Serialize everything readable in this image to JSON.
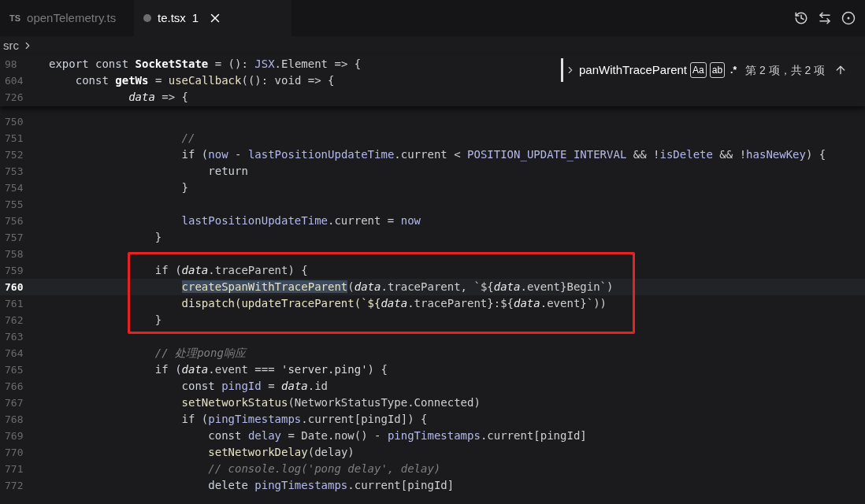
{
  "tabs": [
    {
      "badge": "TS",
      "label": "openTelemetry.ts",
      "selected": false
    },
    {
      "label": "te.tsx",
      "problems": "1",
      "selected": true
    }
  ],
  "breadcrumbs": [
    "src"
  ],
  "sticky_lines": [
    {
      "number": "98",
      "code": [
        {
          "text": "export const ",
          "kind": "kw"
        },
        {
          "text": "SocketState",
          "kind": "b"
        },
        {
          "text": " = (): ",
          "kind": "p"
        },
        {
          "text": "JSX",
          "kind": "var"
        },
        {
          "text": ".Element => {",
          "kind": "p"
        }
      ]
    },
    {
      "number": "604",
      "code": [
        {
          "text": "    const ",
          "kind": "kw"
        },
        {
          "text": "getWs",
          "kind": "b"
        },
        {
          "text": " = ",
          "kind": "p"
        },
        {
          "text": "useCallback",
          "kind": "fn"
        },
        {
          "text": "((): void => {",
          "kind": "p"
        }
      ]
    },
    {
      "number": "726",
      "code": [
        {
          "text": "            data",
          "kind": "it"
        },
        {
          "text": " => {",
          "kind": "p"
        }
      ]
    }
  ],
  "lines": [
    {
      "number": "750",
      "current": false
    },
    {
      "number": "751",
      "current": false,
      "code": [
        {
          "text": "                    //",
          "kind": "cm"
        }
      ]
    },
    {
      "number": "752",
      "current": false,
      "code": [
        {
          "text": "                    if (",
          "kind": "kw"
        },
        {
          "text": "now",
          "kind": "var"
        },
        {
          "text": " - ",
          "kind": "p"
        },
        {
          "text": "lastPositionUpdateTime",
          "kind": "var"
        },
        {
          "text": ".current < ",
          "kind": "p"
        },
        {
          "text": "POSITION_UPDATE_INTERVAL",
          "kind": "var"
        },
        {
          "text": " && !",
          "kind": "p"
        },
        {
          "text": "isDelete",
          "kind": "var"
        },
        {
          "text": " && !",
          "kind": "p"
        },
        {
          "text": "hasNewKey",
          "kind": "var"
        },
        {
          "text": ") {",
          "kind": "p"
        }
      ]
    },
    {
      "number": "753",
      "current": false,
      "code": [
        {
          "text": "                        return",
          "kind": "kw"
        }
      ]
    },
    {
      "number": "754",
      "current": false,
      "code": [
        {
          "text": "                    }",
          "kind": "p"
        }
      ]
    },
    {
      "number": "755",
      "current": false
    },
    {
      "number": "756",
      "current": false,
      "code": [
        {
          "text": "                    lastPositionUpdateTime",
          "kind": "var"
        },
        {
          "text": ".current = ",
          "kind": "p"
        },
        {
          "text": "now",
          "kind": "var"
        }
      ]
    },
    {
      "number": "757",
      "current": false,
      "code": [
        {
          "text": "                }",
          "kind": "p"
        }
      ]
    },
    {
      "number": "758",
      "current": false
    },
    {
      "number": "759",
      "current": false,
      "code": [
        {
          "text": "                if (",
          "kind": "kw"
        },
        {
          "text": "data",
          "kind": "it"
        },
        {
          "text": ".traceParent) {",
          "kind": "p"
        }
      ]
    },
    {
      "number": "760",
      "current": true,
      "code": [
        {
          "text": "                    createSpanWithTraceParent",
          "kind": "sel"
        },
        {
          "text": "(",
          "kind": "p"
        },
        {
          "text": "data",
          "kind": "it"
        },
        {
          "text": ".traceParent, `${",
          "kind": "p"
        },
        {
          "text": "data",
          "kind": "it"
        },
        {
          "text": ".event}Begin`)",
          "kind": "p"
        }
      ]
    },
    {
      "number": "761",
      "current": false,
      "code": [
        {
          "text": "                    dispatch(updateTraceParent(`${",
          "kind": "fn"
        },
        {
          "text": "data",
          "kind": "it"
        },
        {
          "text": ".traceParent}:${",
          "kind": "p"
        },
        {
          "text": "data",
          "kind": "it"
        },
        {
          "text": ".event}`))",
          "kind": "p"
        }
      ]
    },
    {
      "number": "762",
      "current": false,
      "code": [
        {
          "text": "                }",
          "kind": "p"
        }
      ]
    },
    {
      "number": "763",
      "current": false
    },
    {
      "number": "764",
      "current": false,
      "code": [
        {
          "text": "                // 处理pong响应",
          "kind": "cm"
        }
      ]
    },
    {
      "number": "765",
      "current": false,
      "code": [
        {
          "text": "                if (",
          "kind": "kw"
        },
        {
          "text": "data",
          "kind": "it"
        },
        {
          "text": ".event === ",
          "kind": "p"
        },
        {
          "text": "'server.ping'",
          "kind": "str"
        },
        {
          "text": ") {",
          "kind": "p"
        }
      ]
    },
    {
      "number": "766",
      "current": false,
      "code": [
        {
          "text": "                    const ",
          "kind": "kw"
        },
        {
          "text": "pingId",
          "kind": "var"
        },
        {
          "text": " = ",
          "kind": "p"
        },
        {
          "text": "data",
          "kind": "it"
        },
        {
          "text": ".id",
          "kind": "p"
        }
      ]
    },
    {
      "number": "767",
      "current": false,
      "code": [
        {
          "text": "                    setNetworkStatus",
          "kind": "fn"
        },
        {
          "text": "(NetworkStatusType.Connected)",
          "kind": "p"
        }
      ]
    },
    {
      "number": "768",
      "current": false,
      "code": [
        {
          "text": "                    if (",
          "kind": "kw"
        },
        {
          "text": "pingTimestamps",
          "kind": "var"
        },
        {
          "text": ".current[pingId]) {",
          "kind": "p"
        }
      ]
    },
    {
      "number": "769",
      "current": false,
      "code": [
        {
          "text": "                        const ",
          "kind": "kw"
        },
        {
          "text": "delay",
          "kind": "var"
        },
        {
          "text": " = Date.now() - ",
          "kind": "p"
        },
        {
          "text": "pingTimestamps",
          "kind": "var"
        },
        {
          "text": ".current[pingId]",
          "kind": "p"
        }
      ]
    },
    {
      "number": "770",
      "current": false,
      "code": [
        {
          "text": "                        setNetworkDelay",
          "kind": "fn"
        },
        {
          "text": "(delay)",
          "kind": "p"
        }
      ]
    },
    {
      "number": "771",
      "current": false,
      "code": [
        {
          "text": "                        // console.log('pong delay', delay)",
          "kind": "cm"
        }
      ]
    },
    {
      "number": "772",
      "current": false,
      "code": [
        {
          "text": "                        delete ",
          "kind": "kw"
        },
        {
          "text": "pingTimestamps",
          "kind": "var"
        },
        {
          "text": ".current[pingId]",
          "kind": "p"
        }
      ]
    }
  ],
  "find": {
    "value": "panWithTraceParent",
    "options": [
      {
        "label": "Aa",
        "selected": true
      },
      {
        "label": "ab",
        "selected": true
      },
      {
        "label": ".*",
        "selected": false
      }
    ],
    "result": "第 2 项，共 2 项"
  }
}
